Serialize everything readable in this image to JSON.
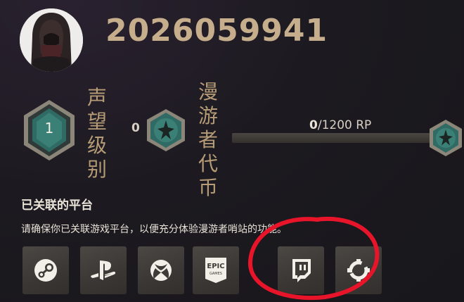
{
  "profile": {
    "user_id": "2026059941",
    "avatar_icon": "hooded-figure-avatar"
  },
  "renown": {
    "level": "1",
    "label": "声望级别"
  },
  "wanderer_token": {
    "count": "0",
    "label": "漫游者代币"
  },
  "rp": {
    "current": "0",
    "total": "/1200 RP",
    "progress_fraction": 0
  },
  "linked_platforms": {
    "title": "已关联的平台",
    "description": "请确保你已关联游戏平台，以便充分体验漫游者哨站的功能。",
    "items": [
      {
        "name": "steam",
        "icon": "steam-icon"
      },
      {
        "name": "playstation",
        "icon": "playstation-icon"
      },
      {
        "name": "xbox",
        "icon": "xbox-icon"
      },
      {
        "name": "epic-games",
        "icon": "epic-games-icon",
        "text_top": "EPIC",
        "text_bottom": "GAMES"
      },
      {
        "name": "twitch",
        "icon": "twitch-icon"
      },
      {
        "name": "other",
        "icon": "broken-gear-icon"
      }
    ]
  },
  "colors": {
    "accent_gold": "#c6ae8c",
    "teal_badge": "#2f6b64",
    "annotation_red": "#e8142a"
  }
}
